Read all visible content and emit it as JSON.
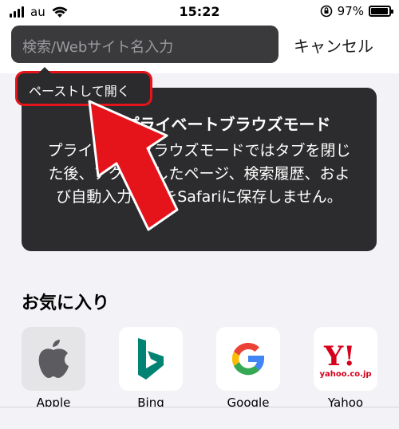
{
  "status_bar": {
    "carrier": "au",
    "time": "15:22",
    "battery": "97%",
    "battery_level": 0.97
  },
  "search": {
    "placeholder": "検索/Webサイト名入力",
    "cancel_label": "キャンセル"
  },
  "paste_menu": {
    "label": "ペーストして開く"
  },
  "private_panel": {
    "title": "プライベートブラウズモード",
    "body": "プライベートブラウズモードではタブを閉じた後、アクセスしたページ、検索履歴、および自動入力情報をSafariに保存しません。"
  },
  "favorites": {
    "title": "お気に入り",
    "items": [
      {
        "label": "Apple",
        "icon": "apple-icon"
      },
      {
        "label": "Bing",
        "icon": "bing-icon"
      },
      {
        "label": "Google",
        "icon": "google-icon"
      },
      {
        "label": "Yahoo",
        "icon": "yahoo-icon",
        "icon_text": "yahoo.co.jp"
      }
    ]
  },
  "colors": {
    "highlight_red": "#e5141b",
    "panel_dark": "#2c2c2e"
  }
}
